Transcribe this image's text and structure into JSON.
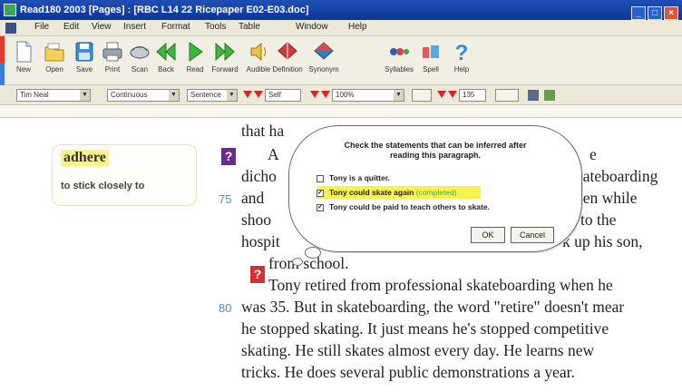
{
  "window": {
    "title": "Read180 2003 [Pages] : [RBC L14 22 Ricepaper E02-E03.doc]"
  },
  "menu": [
    "File",
    "Edit",
    "View",
    "Insert",
    "Format",
    "Tools",
    "Table",
    "Window",
    "Help"
  ],
  "toolbar": {
    "buttons": [
      {
        "label": "New",
        "icon": "new-document-icon"
      },
      {
        "label": "Open",
        "icon": "open-folder-icon"
      },
      {
        "label": "Save",
        "icon": "save-disk-icon"
      },
      {
        "label": "Print",
        "icon": "printer-icon"
      },
      {
        "label": "Scan",
        "icon": "scan-icon"
      },
      {
        "label": "Back",
        "icon": "back-arrow-icon"
      },
      {
        "label": "Read",
        "icon": "play-icon"
      },
      {
        "label": "Forward",
        "icon": "forward-arrow-icon"
      },
      {
        "label": "Audible",
        "icon": "speaker-icon"
      },
      {
        "label": "Definition",
        "icon": "definition-book-icon"
      },
      {
        "label": "Synonym",
        "icon": "synonym-icon"
      },
      {
        "label": "Syllables",
        "icon": "syllables-icon"
      },
      {
        "label": "Spell",
        "icon": "spell-icon"
      },
      {
        "label": "Help",
        "icon": "help-question-icon"
      }
    ]
  },
  "formatbar": {
    "voice": "Tim Neal",
    "mode": "Continuous",
    "unit": "Sentence",
    "speed": "Self",
    "zoom": "100%",
    "pitch": "135"
  },
  "vocab": {
    "word": "adhere",
    "definition": "to stick closely to"
  },
  "question": {
    "prompt_line1": "Check the statements that can be inferred after",
    "prompt_line2": "reading this paragraph.",
    "options": [
      {
        "text": "Tony is a quitter.",
        "checked": false
      },
      {
        "text": "Tony could skate again",
        "note": "(completed)",
        "checked": true
      },
      {
        "text": "Tony could be paid to teach others to skate.",
        "checked": true
      }
    ],
    "ok": "OK",
    "cancel": "Cancel"
  },
  "passage": {
    "l1": "that ha",
    "l2a": "A",
    "l2b": "e",
    "l3a": "dicho",
    "l3b": "kateboarding",
    "l4a": "and",
    "l4b": "pen while",
    "l5a": "shoo",
    "l5b": "to the",
    "l6a": "hospit",
    "l6b": "k up his son,",
    "l7": "from school.",
    "l8": "Tony retired from professional skateboarding when he",
    "l9": "was 35. But in skateboarding, the word \"retire\" doesn't mear",
    "l10": "he stopped skating. It just means he's stopped competitive",
    "l11": "skating. He still skates almost every day. He learns new",
    "l12": "tricks. He does several public demonstrations a year.",
    "num75": "75",
    "num80": "80"
  }
}
